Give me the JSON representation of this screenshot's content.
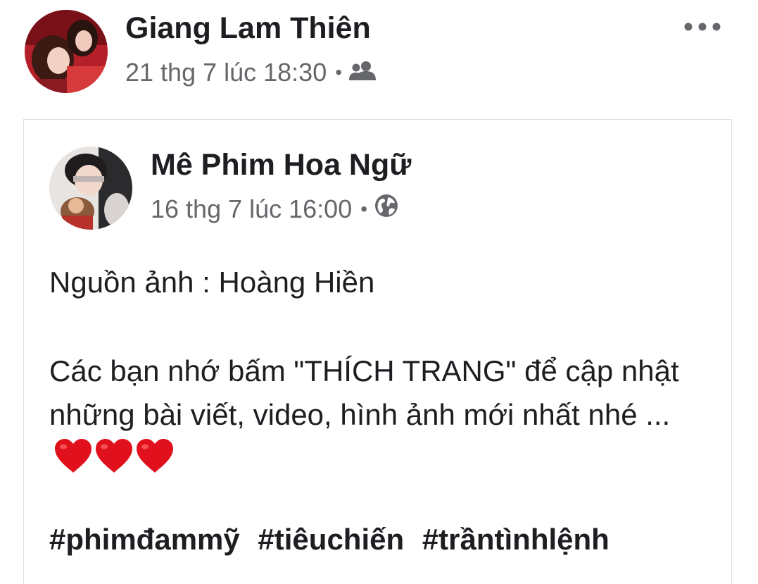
{
  "post": {
    "author": "Giang Lam Thiên",
    "timestamp": "21 thg 7 lúc 18:30",
    "separator": "•",
    "audience_icon": "friends-icon",
    "more_icon": "more-options-icon"
  },
  "shared_post": {
    "author": "Mê Phim Hoa Ngữ",
    "timestamp": "16 thg 7 lúc 16:00",
    "separator": "•",
    "audience_icon": "globe-icon",
    "text_line1": "Nguồn ảnh : Hoàng Hiền",
    "text_line2": "Các bạn nhớ bấm \"THÍCH TRANG\" để cập nhật những bài viết, video, hình ảnh mới nhất nhé ...",
    "emoji": [
      "heart-emoji",
      "heart-emoji",
      "heart-emoji"
    ],
    "hashtags": [
      "#phimđammỹ",
      "#tiêuchiến",
      "#trầntìnhlệnh"
    ]
  },
  "colors": {
    "text_primary": "#1c1e21",
    "text_secondary": "#65676b",
    "heart": "#e0111d",
    "card_border": "#dcdee3"
  }
}
